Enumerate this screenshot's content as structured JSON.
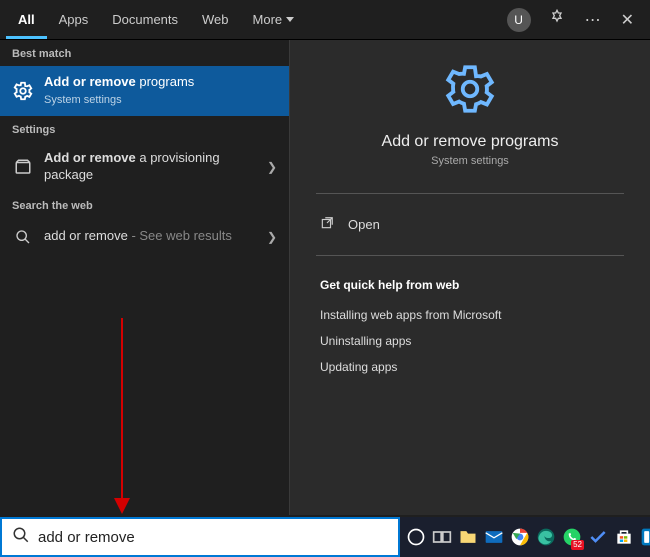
{
  "tabs": {
    "all": "All",
    "apps": "Apps",
    "documents": "Documents",
    "web": "Web",
    "more": "More"
  },
  "user_initial": "U",
  "sections": {
    "best_match": "Best match",
    "settings": "Settings",
    "search_web": "Search the web"
  },
  "best_match": {
    "title_pre": "Add or remove",
    "title_post": " programs",
    "subtitle": "System settings"
  },
  "settings_item": {
    "title_pre": "Add or remove",
    "title_post": " a provisioning package"
  },
  "web_item": {
    "query": "add or remove",
    "suffix": " - See web results"
  },
  "preview": {
    "title": "Add or remove programs",
    "subtitle": "System settings",
    "open": "Open",
    "help_header": "Get quick help from web",
    "links": {
      "l0": "Installing web apps from Microsoft",
      "l1": "Uninstalling apps",
      "l2": "Updating apps"
    }
  },
  "search": {
    "value": "add or remove"
  },
  "taskbar": {
    "whatsapp_badge": "52"
  }
}
